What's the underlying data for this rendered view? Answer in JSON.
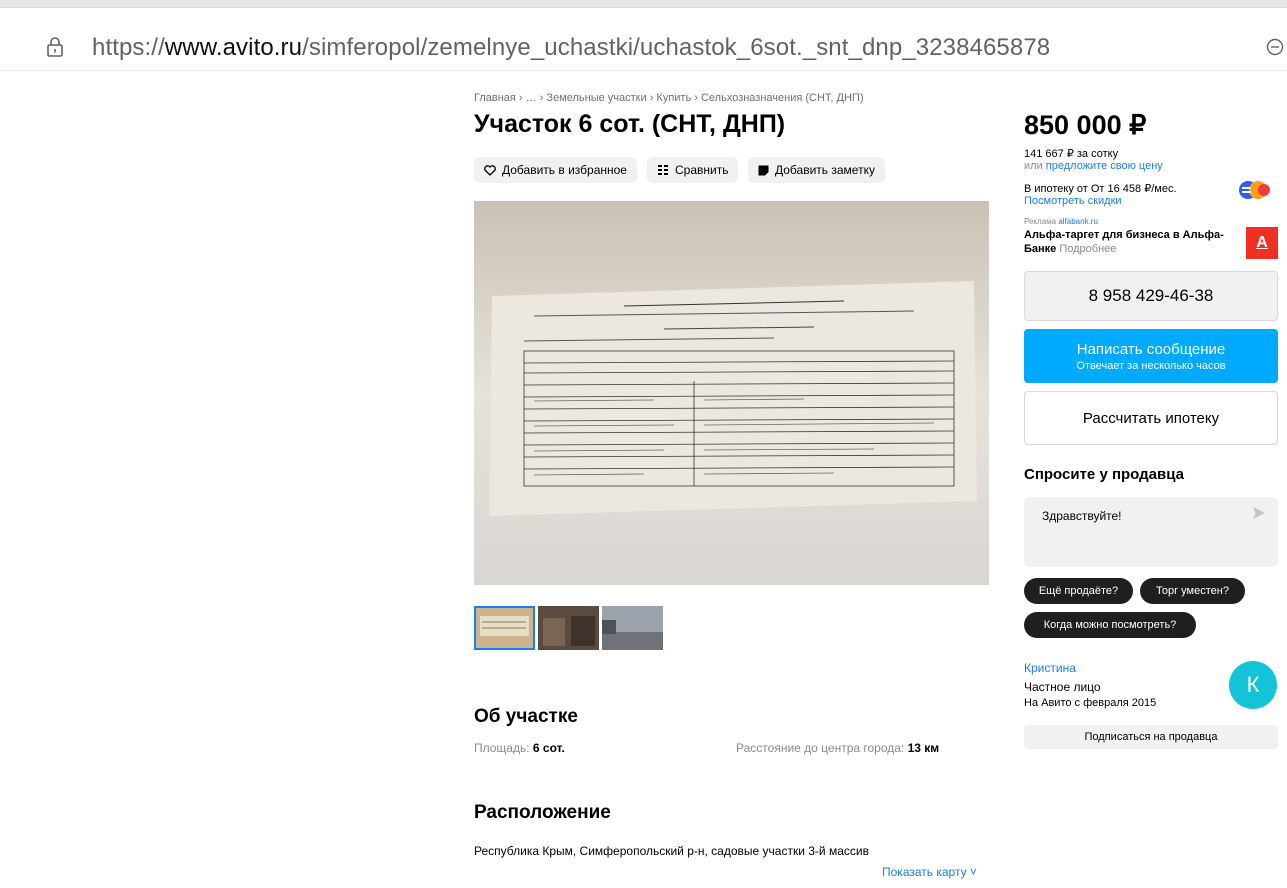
{
  "browser": {
    "url_prefix": "https://",
    "url_domain": "www.avito.ru",
    "url_path": "/simferopol/zemelnye_uchastki/uchastok_6sot._snt_dnp_3238465878"
  },
  "breadcrumb": "Главная › … › Земельные участки › Купить › Сельхозназначения (СНТ, ДНП)",
  "title": "Участок 6 сот. (СНТ, ДНП)",
  "actions": {
    "favorite": "Добавить в избранное",
    "compare": "Сравнить",
    "note": "Добавить заметку"
  },
  "about": {
    "heading": "Об участке",
    "area_label": "Площадь:",
    "area_value": "6 сот.",
    "distance_label": "Расстояние до центра города:",
    "distance_value": "13 км"
  },
  "location": {
    "heading": "Расположение",
    "address": "Республика Крым, Симферопольский р-н, садовые участки 3-й массив",
    "map_link": "Показать карту ˅"
  },
  "price": {
    "value": "850 000 ₽",
    "per_sotka": "141 667 ₽ за сотку",
    "or_text": "или",
    "offer_link": "предложите свою цену",
    "mortgage": "В ипотеку от От 16 458 ₽/мес.",
    "discounts_link": "Посмотреть скидки"
  },
  "ad": {
    "label": "Реклама",
    "site": "alfabank.ru",
    "text_line1": "Альфа-таргет для бизнеса в Альфа-",
    "text_line2": "Банке",
    "more": "Подробнее",
    "logo_letter": "А"
  },
  "contact": {
    "phone": "8 958 429-46-38",
    "message_label": "Написать сообщение",
    "message_sub": "Отвечает за несколько часов",
    "mortgage_calc": "Рассчитать ипотеку"
  },
  "ask": {
    "heading": "Спросите у продавца",
    "input_value": "Здравствуйте!",
    "chips": [
      "Ещё продаёте?",
      "Торг уместен?",
      "Когда можно посмотреть?"
    ]
  },
  "seller": {
    "name": "Кристина",
    "type": "Частное лицо",
    "since": "На Авито с февраля 2015",
    "avatar_letter": "К",
    "subscribe": "Подписаться на продавца"
  },
  "colors": {
    "link": "#1b7df5",
    "primary_button": "#00aaff",
    "avatar": "#13c3d6",
    "alfa_red": "#ef3124"
  }
}
